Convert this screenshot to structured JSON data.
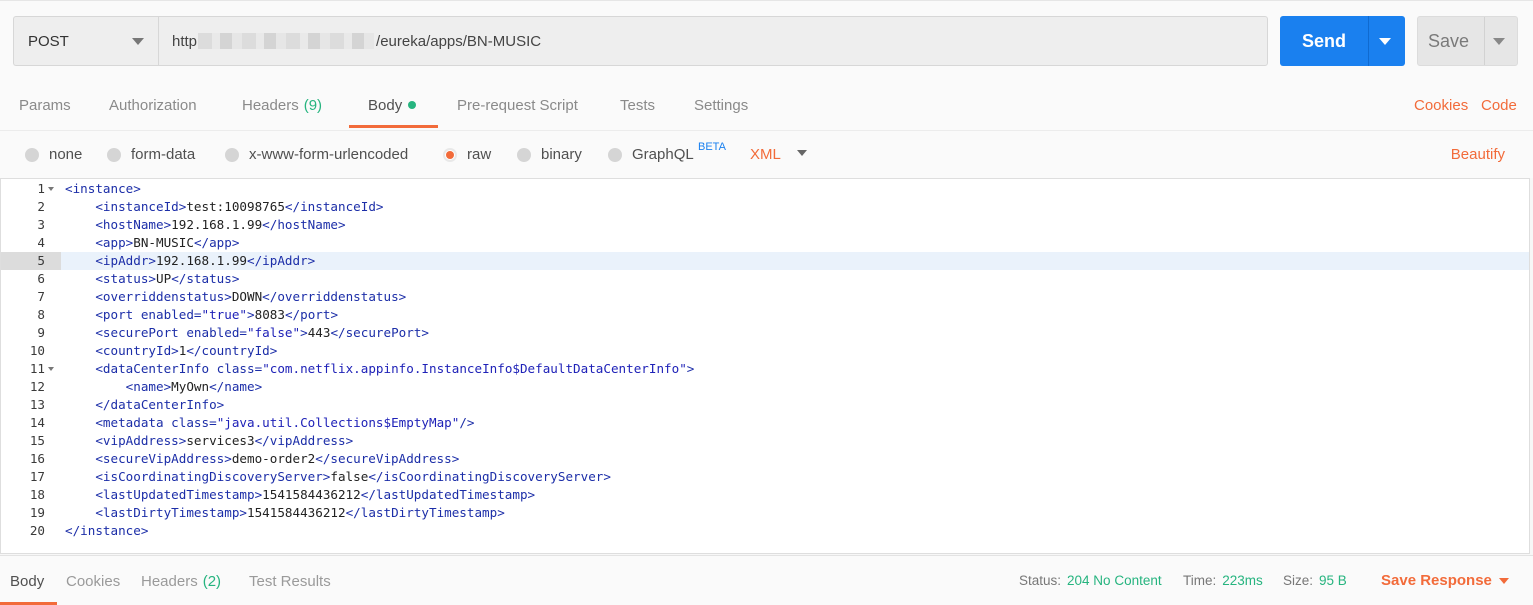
{
  "request": {
    "method": "POST",
    "url_prefix": "http",
    "url_suffix": "/eureka/apps/BN-MUSIC",
    "send_label": "Send",
    "save_label": "Save"
  },
  "tabs": [
    {
      "label": "Params"
    },
    {
      "label": "Authorization"
    },
    {
      "label": "Headers",
      "count": "(9)"
    },
    {
      "label": "Body"
    },
    {
      "label": "Pre-request Script"
    },
    {
      "label": "Tests"
    },
    {
      "label": "Settings"
    }
  ],
  "links": {
    "cookies": "Cookies",
    "code": "Code"
  },
  "body_modes": {
    "none": "none",
    "form_data": "form-data",
    "urlencoded": "x-www-form-urlencoded",
    "raw": "raw",
    "binary": "binary",
    "graphql": "GraphQL",
    "beta": "BETA",
    "format": "XML",
    "beautify": "Beautify"
  },
  "editor": {
    "active_line": 5,
    "lines": [
      "<instance>",
      "    <instanceId>test:10098765</instanceId>",
      "    <hostName>192.168.1.99</hostName>",
      "    <app>BN-MUSIC</app>",
      "    <ipAddr>192.168.1.99</ipAddr>",
      "    <status>UP</status>",
      "    <overriddenstatus>DOWN</overriddenstatus>",
      "    <port enabled=\"true\">8083</port>",
      "    <securePort enabled=\"false\">443</securePort>",
      "    <countryId>1</countryId>",
      "    <dataCenterInfo class=\"com.netflix.appinfo.InstanceInfo$DefaultDataCenterInfo\">",
      "        <name>MyOwn</name>",
      "    </dataCenterInfo>",
      "    <metadata class=\"java.util.Collections$EmptyMap\"/>",
      "    <vipAddress>services3</vipAddress>",
      "    <secureVipAddress>demo-order2</secureVipAddress>",
      "    <isCoordinatingDiscoveryServer>false</isCoordinatingDiscoveryServer>",
      "    <lastUpdatedTimestamp>1541584436212</lastUpdatedTimestamp>",
      "    <lastDirtyTimestamp>1541584436212</lastDirtyTimestamp>",
      "</instance>"
    ],
    "foldable_lines": [
      1,
      11
    ]
  },
  "response": {
    "tabs": [
      {
        "label": "Body"
      },
      {
        "label": "Cookies"
      },
      {
        "label": "Headers",
        "count": "(2)"
      },
      {
        "label": "Test Results"
      }
    ],
    "status_label": "Status:",
    "status_value": "204 No Content",
    "time_label": "Time:",
    "time_value": "223ms",
    "size_label": "Size:",
    "size_value": "95 B",
    "save_response": "Save Response"
  },
  "colors": {
    "accent": "#f26b3a",
    "primary": "#1a80ef",
    "success": "#26b47f"
  }
}
